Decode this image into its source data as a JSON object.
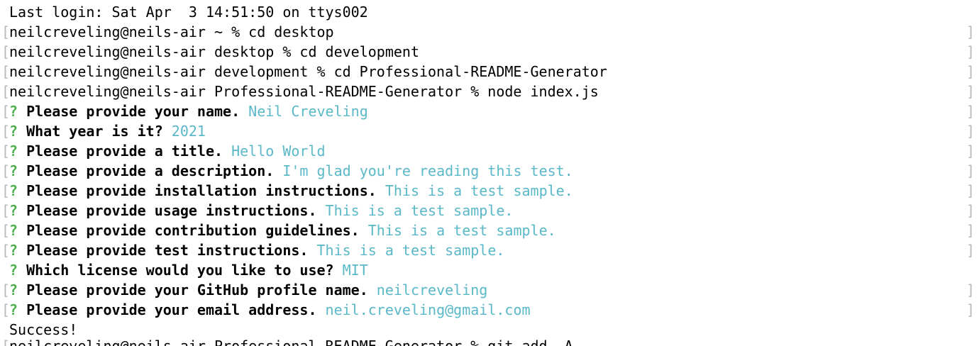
{
  "terminal": {
    "login_line": "Last login: Sat Apr  3 14:51:50 on ttys002",
    "commands": [
      {
        "prompt": "neilcreveling@neils-air ~ % ",
        "command": "cd desktop"
      },
      {
        "prompt": "neilcreveling@neils-air desktop % ",
        "command": "cd development"
      },
      {
        "prompt": "neilcreveling@neils-air development % ",
        "command": "cd Professional-README-Generator"
      },
      {
        "prompt": "neilcreveling@neils-air Professional-README-Generator % ",
        "command": "node index.js"
      }
    ],
    "qmark": "?",
    "questions": [
      {
        "question": "Please provide your name.",
        "answer": "Neil Creveling"
      },
      {
        "question": "What year is it?",
        "answer": "2021"
      },
      {
        "question": "Please provide a title.",
        "answer": "Hello World"
      },
      {
        "question": "Please provide a description.",
        "answer": "I'm glad you're reading this test."
      },
      {
        "question": "Please provide installation instructions.",
        "answer": "This is a test sample."
      },
      {
        "question": "Please provide usage instructions.",
        "answer": "This is a test sample."
      },
      {
        "question": "Please provide contribution guidelines.",
        "answer": "This is a test sample."
      },
      {
        "question": "Please provide test instructions.",
        "answer": "This is a test sample."
      },
      {
        "question": "Which license would you like to use?",
        "answer": "MIT"
      },
      {
        "question": "Please provide your GitHub profile name.",
        "answer": "neilcreveling"
      },
      {
        "question": "Please provide your email address.",
        "answer": "neil.creveling@gmail.com"
      }
    ],
    "success_line": "Success!",
    "partial_line": "neilcreveling@neils-air Professional-README-Generator % git add -A"
  },
  "colors": {
    "background": "#ffffff",
    "text": "#000000",
    "qmark": "#4caf50",
    "answer": "#5ab8c8",
    "bracket": "#b8b8b8"
  }
}
